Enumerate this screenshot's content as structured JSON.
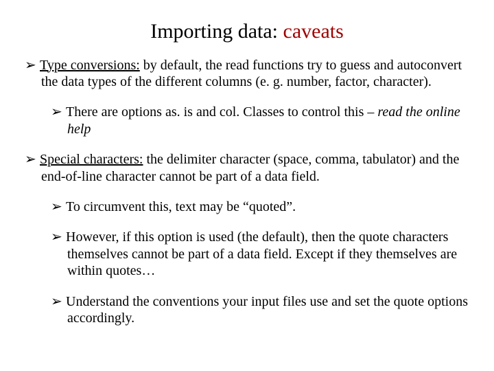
{
  "title": {
    "part1": "Importing data:",
    "part2": " caveats"
  },
  "blocks": [
    {
      "lead_underlined": "Type conversions:",
      "lead_rest": " by default, the read functions try to guess and autoconvert the data types of the different columns (e. g. number, factor, character).",
      "subs": [
        {
          "plain": "There are options as. is and col. Classes to control this – ",
          "ital": "read the online help"
        }
      ]
    },
    {
      "lead_underlined": "Special characters:",
      "lead_rest": " the delimiter character (space, comma, tabulator) and the end-of-line character cannot be part of a data field.",
      "subs": [
        {
          "plain": "To circumvent this, text may be “quoted”."
        },
        {
          "plain": "However, if this option is used (the default), then the quote characters themselves cannot be part of a data field. Except if they themselves are within quotes…"
        },
        {
          "plain": "Understand the conventions your input files use and set the quote options accordingly."
        }
      ]
    }
  ],
  "glyphs": {
    "arrow": "➢"
  }
}
